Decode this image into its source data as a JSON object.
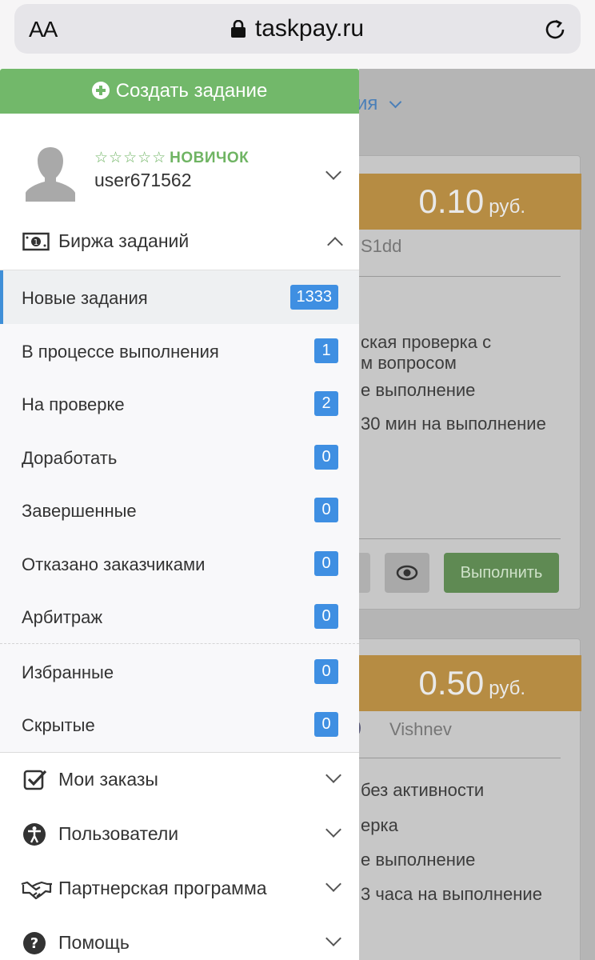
{
  "browser": {
    "text_size_label": "AA",
    "url": "taskpay.ru"
  },
  "background": {
    "filter_fragment": "ия",
    "cards": [
      {
        "price": "0.10",
        "currency": "руб.",
        "author": "S1dd",
        "lines": [
          "ская проверка с",
          "м вопросом",
          "е выполнение",
          "30 мин на выполнение"
        ],
        "do_button": "Выполнить"
      },
      {
        "price": "0.50",
        "currency": "руб.",
        "author": "Vishnev",
        "lines": [
          "без активности",
          "ерка",
          "е выполнение",
          "3 часа на выполнение"
        ]
      }
    ]
  },
  "drawer": {
    "create_button": "Создать задание",
    "profile": {
      "stars": "☆☆☆☆☆",
      "level": "НОВИЧОК",
      "username": "user671562"
    },
    "exchange": {
      "label": "Биржа заданий",
      "items": [
        {
          "label": "Новые задания",
          "count": "1333"
        },
        {
          "label": "В процессе выполнения",
          "count": "1"
        },
        {
          "label": "На проверке",
          "count": "2"
        },
        {
          "label": "Доработать",
          "count": "0"
        },
        {
          "label": "Завершенные",
          "count": "0"
        },
        {
          "label": "Отказано заказчиками",
          "count": "0"
        },
        {
          "label": "Арбитраж",
          "count": "0"
        },
        {
          "label": "Избранные",
          "count": "0"
        },
        {
          "label": "Скрытые",
          "count": "0"
        }
      ]
    },
    "sections": [
      {
        "label": "Мои заказы",
        "icon": "checkbox-icon"
      },
      {
        "label": "Пользователи",
        "icon": "accessibility-icon"
      },
      {
        "label": "Партнерская программа",
        "icon": "handshake-icon"
      },
      {
        "label": "Помощь",
        "icon": "question-icon"
      }
    ]
  },
  "colors": {
    "accent_green": "#72b86a",
    "badge_blue": "#3f8fe2",
    "active_border": "#3f8fd8"
  }
}
